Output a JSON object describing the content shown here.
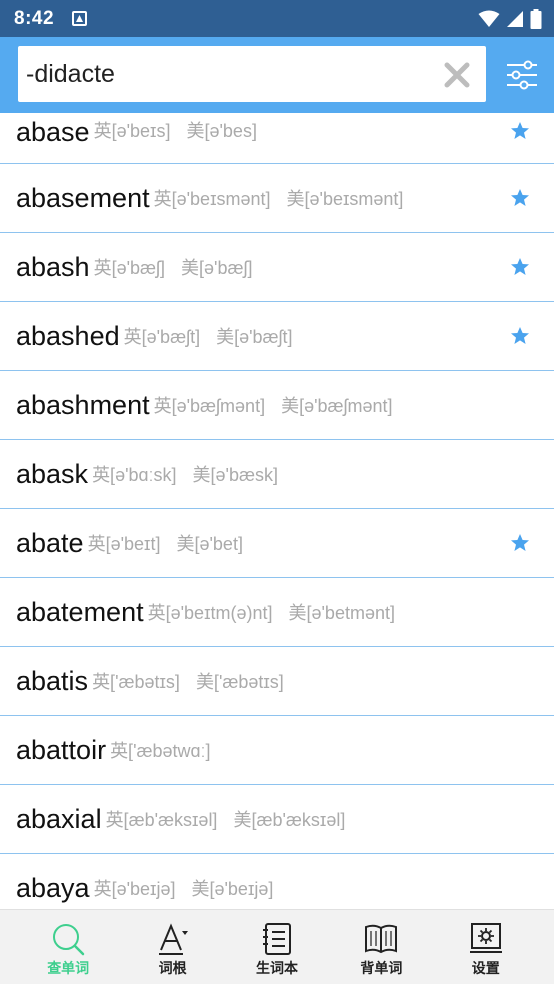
{
  "status_bar": {
    "time": "8:42"
  },
  "search": {
    "value": "-didacte"
  },
  "words": [
    {
      "word": "abase",
      "uk": "英[ə'beɪs]",
      "us": "美[ə'bes]",
      "starred": true
    },
    {
      "word": "abasement",
      "uk": "英[ə'beɪsmənt]",
      "us": "美[ə'beɪsmənt]",
      "starred": true
    },
    {
      "word": "abash",
      "uk": "英[ə'bæʃ]",
      "us": "美[ə'bæʃ]",
      "starred": true
    },
    {
      "word": "abashed",
      "uk": "英[ə'bæʃt]",
      "us": "美[ə'bæʃt]",
      "starred": true
    },
    {
      "word": "abashment",
      "uk": "英[ə'bæʃmənt]",
      "us": "美[ə'bæʃmənt]",
      "starred": false
    },
    {
      "word": "abask",
      "uk": "英[ə'bɑːsk]",
      "us": "美[ə'bæsk]",
      "starred": false
    },
    {
      "word": "abate",
      "uk": "英[ə'beɪt]",
      "us": "美[ə'bet]",
      "starred": true
    },
    {
      "word": "abatement",
      "uk": "英[ə'beɪtm(ə)nt]",
      "us": "美[ə'betmənt]",
      "starred": false
    },
    {
      "word": "abatis",
      "uk": "英['æbətɪs]",
      "us": "美['æbətɪs]",
      "starred": false
    },
    {
      "word": "abattoir",
      "uk": "英['æbətwɑː]",
      "us": "",
      "starred": false
    },
    {
      "word": "abaxial",
      "uk": "英[æb'æksɪəl]",
      "us": "美[æb'æksɪəl]",
      "starred": false
    },
    {
      "word": "abaya",
      "uk": "英[ə'beɪjə]",
      "us": "美[ə'beɪjə]",
      "starred": false
    }
  ],
  "bottom_nav": [
    {
      "label": "查单词",
      "icon": "search-icon",
      "active": true
    },
    {
      "label": "词根",
      "icon": "letter-a-icon",
      "active": false
    },
    {
      "label": "生词本",
      "icon": "notebook-icon",
      "active": false
    },
    {
      "label": "背单词",
      "icon": "open-book-icon",
      "active": false
    },
    {
      "label": "设置",
      "icon": "settings-icon",
      "active": false
    }
  ],
  "colors": {
    "status_bar": "#2f5f93",
    "toolbar": "#55aaf0",
    "divider": "#8ec3ef",
    "star": "#4aa3ee",
    "active_nav": "#3ecf8e",
    "pronunciation": "#aaaaaa"
  }
}
